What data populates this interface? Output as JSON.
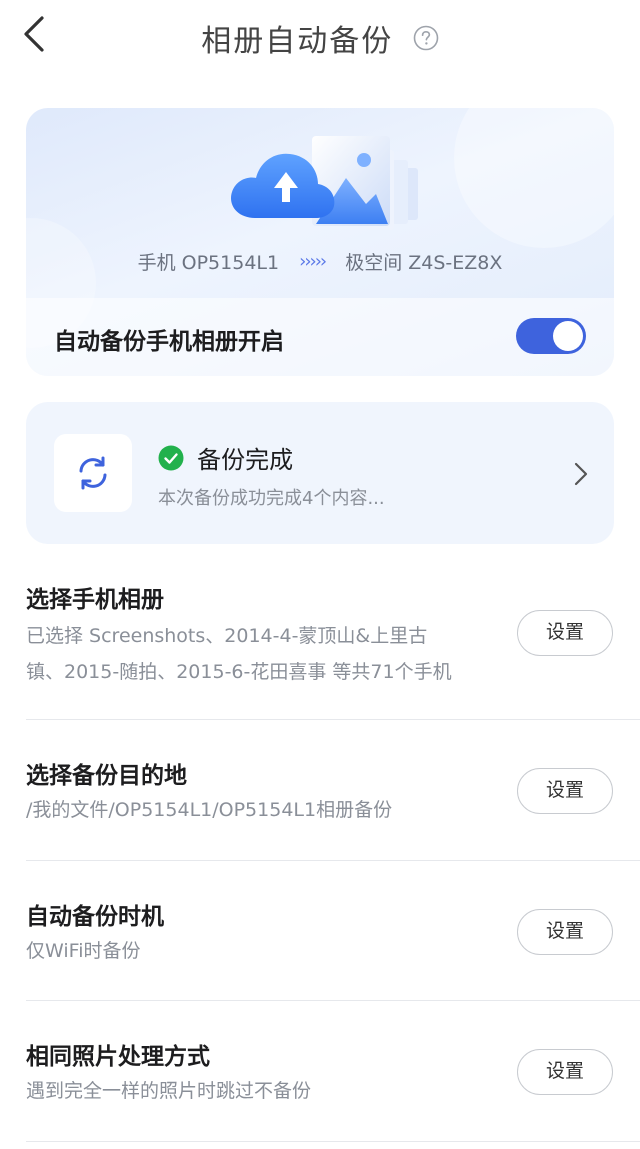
{
  "header": {
    "title": "相册自动备份"
  },
  "hero": {
    "source_device": "手机 OP5154L1",
    "arrows": "›››››",
    "target_device": "极空间 Z4S-EZ8X",
    "toggle_label": "自动备份手机相册开启",
    "toggle_on": true
  },
  "status": {
    "title": "备份完成",
    "subtitle": "本次备份成功完成4个内容..."
  },
  "settings": [
    {
      "title": "选择手机相册",
      "desc_line1": "已选择 Screenshots、2014-4-蒙顶山&上里古",
      "desc_line2": "镇、2015-随拍、2015-6-花田喜事 等共71个手机",
      "button": "设置"
    },
    {
      "title": "选择备份目的地",
      "desc": "/我的文件/OP5154L1/OP5154L1相册备份",
      "button": "设置"
    },
    {
      "title": "自动备份时机",
      "desc": "仅WiFi时备份",
      "button": "设置"
    },
    {
      "title": "相同照片处理方式",
      "desc": "遇到完全一样的照片时跳过不备份",
      "button": "设置"
    }
  ],
  "colors": {
    "accent": "#3e63dd",
    "success": "#22b14c",
    "hero_bg": "#e6eefc",
    "card_bg": "#f0f5fd"
  }
}
